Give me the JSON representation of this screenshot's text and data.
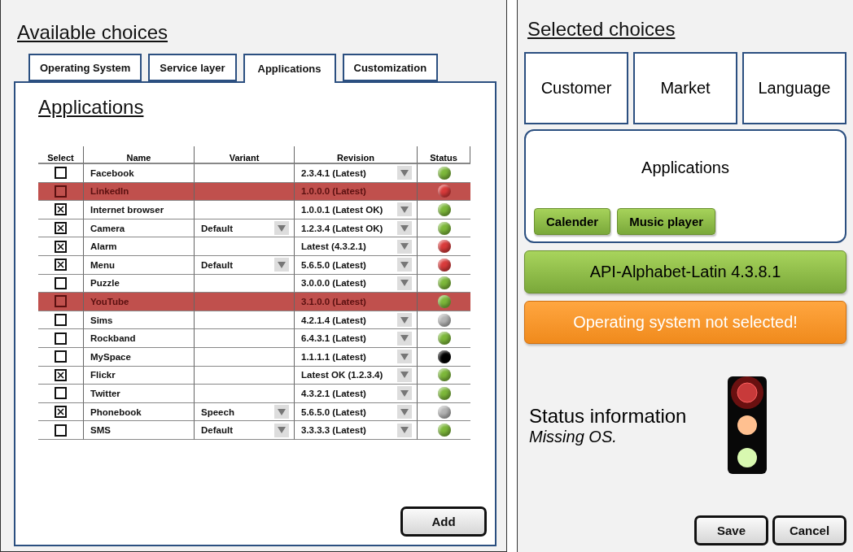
{
  "left": {
    "title": "Available choices",
    "tabs": [
      {
        "label": "Operating System",
        "selected": false
      },
      {
        "label": "Service layer",
        "selected": false
      },
      {
        "label": "Applications",
        "selected": true
      },
      {
        "label": "Customization",
        "selected": false
      }
    ],
    "heading": "Applications",
    "columns": [
      "Select",
      "Name",
      "Variant",
      "Revision",
      "Status"
    ],
    "rows": [
      {
        "checked": false,
        "name": "Facebook",
        "revision": "2.3.4.1 (Latest)",
        "color": "#7db83a",
        "highlighted": false
      },
      {
        "checked": false,
        "name": "LinkedIn",
        "revision": "1.0.0.0 (Latest)",
        "color": "#d93b3b",
        "highlighted": true
      },
      {
        "checked": true,
        "name": "Internet browser",
        "revision": "1.0.0.1 (Latest OK)",
        "color": "#7db83a",
        "highlighted": false
      },
      {
        "checked": true,
        "name": "Camera",
        "variant": "Default",
        "revision": "1.2.3.4 (Latest OK)",
        "color": "#7db83a",
        "highlighted": false
      },
      {
        "checked": true,
        "name": "Alarm",
        "revision": "Latest (4.3.2.1)",
        "color": "#d93b3b",
        "highlighted": false
      },
      {
        "checked": true,
        "name": "Menu",
        "variant": "Default",
        "revision": "5.6.5.0 (Latest)",
        "color": "#d93b3b",
        "highlighted": false
      },
      {
        "checked": false,
        "name": "Puzzle",
        "revision": "3.0.0.0 (Latest)",
        "color": "#7db83a",
        "highlighted": false
      },
      {
        "checked": false,
        "name": "YouTube",
        "revision": "3.1.0.0 (Latest)",
        "color": "#7db83a",
        "highlighted": true
      },
      {
        "checked": false,
        "name": "Sims",
        "revision": "4.2.1.4 (Latest)",
        "color": "#b4b4b4",
        "highlighted": false
      },
      {
        "checked": false,
        "name": "Rockband",
        "revision": "6.4.3.1 (Latest)",
        "color": "#7db83a",
        "highlighted": false
      },
      {
        "checked": false,
        "name": "MySpace",
        "revision": "1.1.1.1 (Latest)",
        "color": "#000000",
        "highlighted": false
      },
      {
        "checked": true,
        "name": "Flickr",
        "revision": "Latest OK (1.2.3.4)",
        "color": "#7db83a",
        "highlighted": false
      },
      {
        "checked": false,
        "name": "Twitter",
        "revision": "4.3.2.1 (Latest)",
        "color": "#7db83a",
        "highlighted": false
      },
      {
        "checked": true,
        "name": "Phonebook",
        "variant": "Speech",
        "revision": "5.6.5.0 (Latest)",
        "color": "#b4b4b4",
        "highlighted": false
      },
      {
        "checked": false,
        "name": "SMS",
        "variant": "Default",
        "revision": "3.3.3.3 (Latest)",
        "color": "#7db83a",
        "highlighted": false
      }
    ],
    "add_button": "Add"
  },
  "right": {
    "title": "Selected choices",
    "choice_boxes": [
      "Customer",
      "Market",
      "Language"
    ],
    "applications": {
      "title": "Applications",
      "items": [
        "Calender",
        "Music player"
      ]
    },
    "api_bar": "API-Alphabet-Latin 4.3.8.1",
    "warning_bar": "Operating system not selected!",
    "status": {
      "title": "Status information",
      "message": "Missing OS.",
      "lights": [
        {
          "color": "#c83a3a",
          "on": true
        },
        {
          "color": "#ffc090",
          "on": false
        },
        {
          "color": "#d8f8b0",
          "on": false
        }
      ]
    },
    "buttons": [
      "Save",
      "Cancel"
    ]
  }
}
